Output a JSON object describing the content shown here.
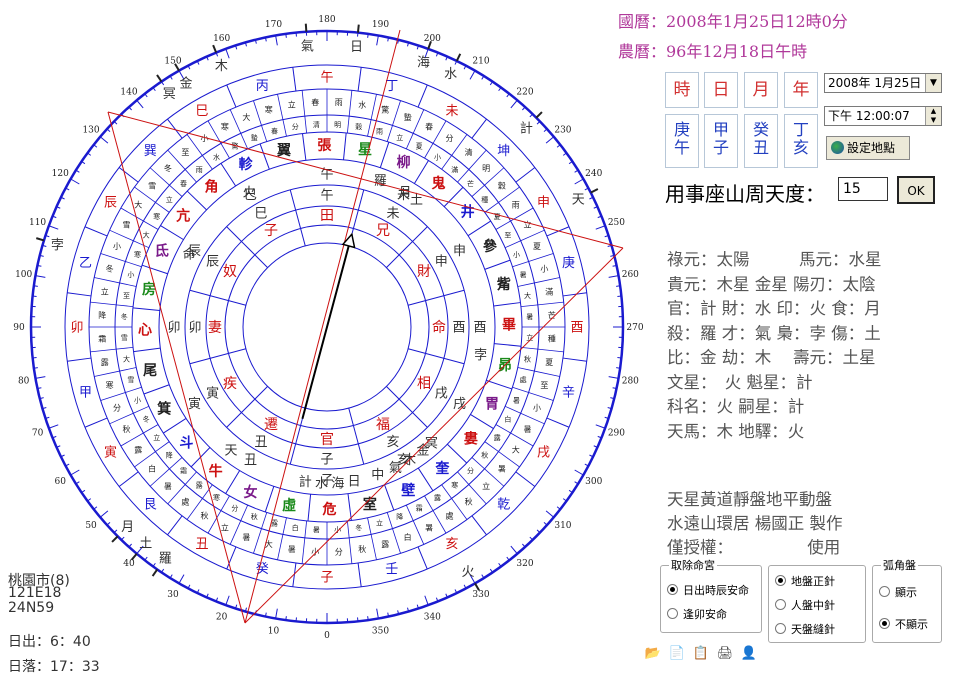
{
  "header": {
    "solar_date": "國曆：2008年1月25日12時0分",
    "lunar_date": "農曆：96年12月18日午時"
  },
  "pillars": [
    {
      "label": "時",
      "stem": "庚",
      "branch": "午"
    },
    {
      "label": "日",
      "stem": "甲",
      "branch": "子"
    },
    {
      "label": "月",
      "stem": "癸",
      "branch": "丑"
    },
    {
      "label": "年",
      "stem": "丁",
      "branch": "亥"
    }
  ],
  "controls": {
    "date_value": "2008年  1月25日",
    "time_value": "下午 12:00:07",
    "location_button": "設定地點",
    "degree_label": "用事座山周天度：",
    "degree_value": "15",
    "ok_button": "OK"
  },
  "info_lines": [
    "祿元：太陽　　　馬元：水星",
    "貴元：木星 金星 陽刃：太陰",
    "官：計 財：水 印：火 食：月",
    "殺：羅 才：氣 梟：孛 傷：土",
    "比：金 劫：木　 壽元：土星",
    "文星：　火 魁星：計",
    "科名：火 嗣星：計",
    "天馬：木 地驛：火"
  ],
  "credits": {
    "line1": "天星黃道靜盤地平動盤",
    "line2": "水遠山環居 楊國正 製作",
    "line3": "僅授權：　　　　　使用"
  },
  "options": {
    "group1": {
      "title": "取除命宮",
      "items": [
        {
          "label": "日出時辰安命",
          "on": true
        },
        {
          "label": "逢卯安命",
          "on": false
        }
      ]
    },
    "group2": {
      "title": "",
      "items": [
        {
          "label": "地盤正針",
          "on": true
        },
        {
          "label": "人盤中針",
          "on": false
        },
        {
          "label": "天盤縫針",
          "on": false
        }
      ]
    },
    "group3": {
      "title": "弧角盤",
      "items": [
        {
          "label": "顯示",
          "on": false
        },
        {
          "label": "不顯示",
          "on": true
        }
      ]
    }
  },
  "location": {
    "city": "桃園市(8)",
    "lon": "121E18",
    "lat": "24N59",
    "sunrise": "日出：6：40",
    "sunset": "日落：17：33"
  },
  "chart_data": {
    "type": "astrolabe",
    "degree_labels": [
      "0",
      "10",
      "20",
      "30",
      "40",
      "50",
      "60",
      "70",
      "80",
      "90",
      "100",
      "110",
      "120",
      "130",
      "140",
      "150",
      "160",
      "170",
      "180",
      "190",
      "200",
      "210",
      "220",
      "230",
      "240",
      "250",
      "260",
      "270",
      "280",
      "290",
      "300",
      "310",
      "320",
      "330",
      "340",
      "350"
    ],
    "mountains_24": [
      "子",
      "癸",
      "丑",
      "艮",
      "寅",
      "甲",
      "卯",
      "乙",
      "辰",
      "巽",
      "巳",
      "丙",
      "午",
      "丁",
      "未",
      "坤",
      "申",
      "庚",
      "酉",
      "辛",
      "戌",
      "乾",
      "亥",
      "壬"
    ],
    "mansions_28": [
      "虛",
      "女",
      "牛",
      "斗",
      "箕",
      "尾",
      "心",
      "房",
      "氐",
      "亢",
      "角",
      "軫",
      "翼",
      "張",
      "星",
      "柳",
      "鬼",
      "井",
      "參",
      "觜",
      "畢",
      "昴",
      "胃",
      "婁",
      "奎",
      "壁",
      "室",
      "危"
    ],
    "houses_12": [
      "官",
      "遷",
      "疾",
      "妻",
      "奴",
      "子",
      "田",
      "兄",
      "財",
      "命",
      "相",
      "福"
    ],
    "inner_branches": [
      "子",
      "丑",
      "寅",
      "卯",
      "辰",
      "巳",
      "午",
      "未",
      "申",
      "酉",
      "戌",
      "亥"
    ],
    "planets_outer": [
      {
        "name": "日",
        "deg": 186
      },
      {
        "name": "氣",
        "deg": 176
      },
      {
        "name": "木",
        "deg": 158
      },
      {
        "name": "冥",
        "deg": 146
      },
      {
        "name": "金",
        "deg": 150
      },
      {
        "name": "孛",
        "deg": 107
      },
      {
        "name": "月",
        "deg": 45
      },
      {
        "name": "土",
        "deg": 40
      },
      {
        "name": "羅",
        "deg": 35
      },
      {
        "name": "火",
        "deg": 330
      },
      {
        "name": "天",
        "deg": 243
      },
      {
        "name": "計",
        "deg": 225
      },
      {
        "name": "水",
        "deg": 206
      },
      {
        "name": "海",
        "deg": 200
      }
    ],
    "planets_inner": [
      {
        "name": "月",
        "deg": 210
      },
      {
        "name": "土",
        "deg": 215
      },
      {
        "name": "羅",
        "deg": 200
      },
      {
        "name": "火",
        "deg": 150
      },
      {
        "name": "命",
        "deg": 118
      },
      {
        "name": "孛",
        "deg": 280
      },
      {
        "name": "冥",
        "deg": 318
      },
      {
        "name": "金",
        "deg": 322
      },
      {
        "name": "木",
        "deg": 328
      },
      {
        "name": "氣",
        "deg": 334
      },
      {
        "name": "中",
        "deg": 341
      },
      {
        "name": "日",
        "deg": 350
      },
      {
        "name": "海",
        "deg": 356
      },
      {
        "name": "水",
        "deg": 2
      },
      {
        "name": "計",
        "deg": 8
      },
      {
        "name": "天",
        "deg": 38
      }
    ],
    "pointer_deg": 15
  },
  "colors": {
    "blue": "#1a1acf",
    "red": "#cc1111",
    "purple": "#b0389a",
    "green": "#1a8a1a"
  }
}
